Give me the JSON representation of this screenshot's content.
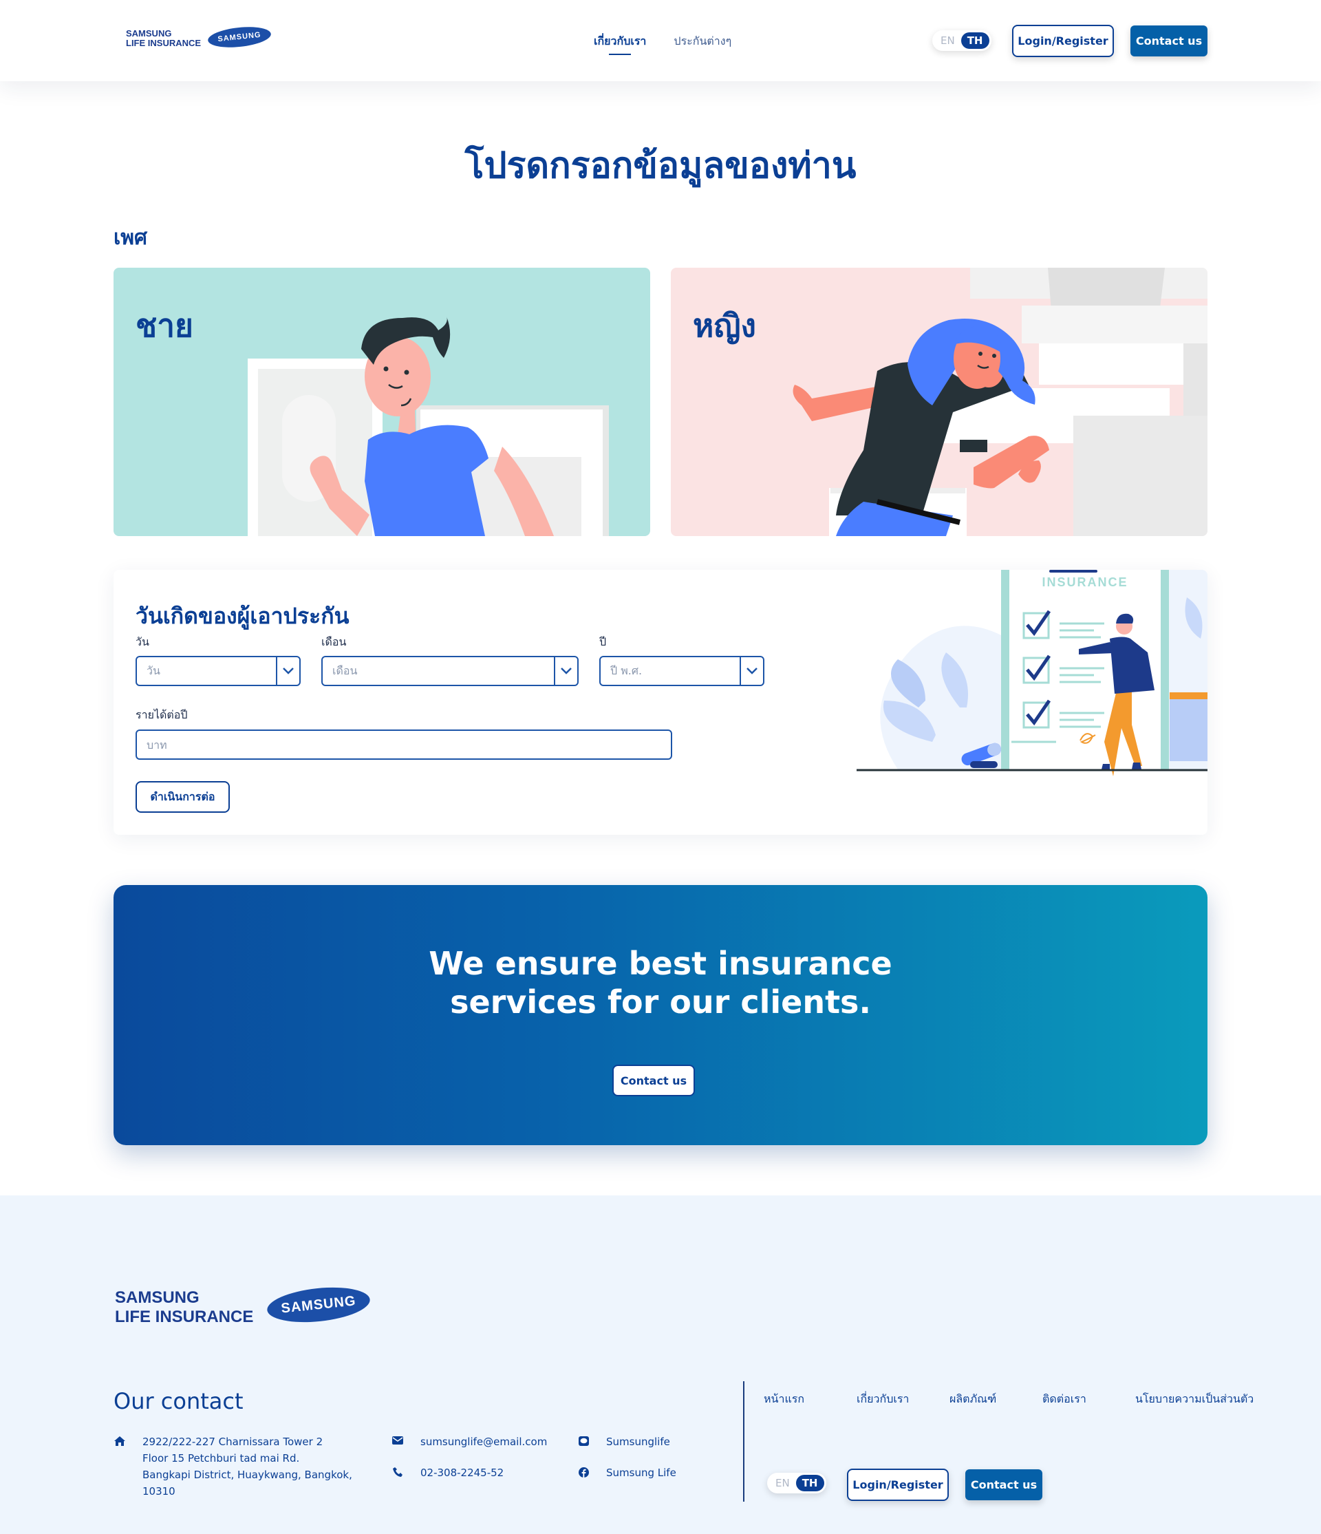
{
  "header": {
    "logo": {
      "line1": "SAMSUNG",
      "line2": "LIFE INSURANCE",
      "brand": "SAMSUNG"
    },
    "nav": [
      {
        "label": "เกี่ยวกับเรา",
        "active": true
      },
      {
        "label": "ประกันต่างๆ",
        "active": false
      }
    ],
    "lang": {
      "en": "EN",
      "th": "TH",
      "selected": "TH"
    },
    "login_label": "Login/Register",
    "contact_label": "Contact us"
  },
  "main": {
    "title": "โปรดกรอกข้อมูลของท่าน",
    "gender_section_label": "เพศ",
    "gender_options": [
      {
        "label": "ชาย",
        "bg": "#b3e4e1"
      },
      {
        "label": "หญิง",
        "bg": "#fbe3e3"
      }
    ],
    "form": {
      "title": "วันเกิดของผู้เอาประกัน",
      "day": {
        "label": "วัน",
        "placeholder": "วัน"
      },
      "month": {
        "label": "เดือน",
        "placeholder": "เดือน"
      },
      "year": {
        "label": "ปี",
        "placeholder": "ปี พ.ศ."
      },
      "income": {
        "label": "รายได้ต่อปี",
        "placeholder": "บาท"
      },
      "continue_label": "ดำเนินการต่อ",
      "illustration_text": "INSURANCE"
    }
  },
  "banner": {
    "title_line1": "We ensure best insurance",
    "title_line2": "services for our clients.",
    "button_label": "Contact us"
  },
  "footer": {
    "logo": {
      "line1": "SAMSUNG",
      "line2": "LIFE INSURANCE",
      "brand": "SAMSUNG"
    },
    "contact_title": "Our contact",
    "address": [
      "2922/222-227 Charnissara Tower 2",
      "Floor 15 Petchburi tad mai Rd.",
      "Bangkapi District, Huaykwang, Bangkok,",
      "10310"
    ],
    "email": "sumsunglife@email.com",
    "phone": "02-308-2245-52",
    "line": "Sumsunglife",
    "facebook": "Sumsung Life",
    "links": [
      "หน้าแรก",
      "เกี่ยวกับเรา",
      "ผลิตภัณฑ์",
      "ติดต่อเรา",
      "นโยบายความเป็นส่วนตัว"
    ],
    "lang": {
      "en": "EN",
      "th": "TH"
    },
    "login_label": "Login/Register",
    "contact_label": "Contact us"
  },
  "colors": {
    "primary": "#0b3f94",
    "button": "#0560a8",
    "footer_bg": "#eef5fd",
    "male_card": "#b3e4e1",
    "female_card": "#fbe3e3"
  },
  "icons": [
    "home-icon",
    "envelope-icon",
    "phone-icon",
    "line-icon",
    "facebook-icon",
    "chevron-down-icon"
  ]
}
